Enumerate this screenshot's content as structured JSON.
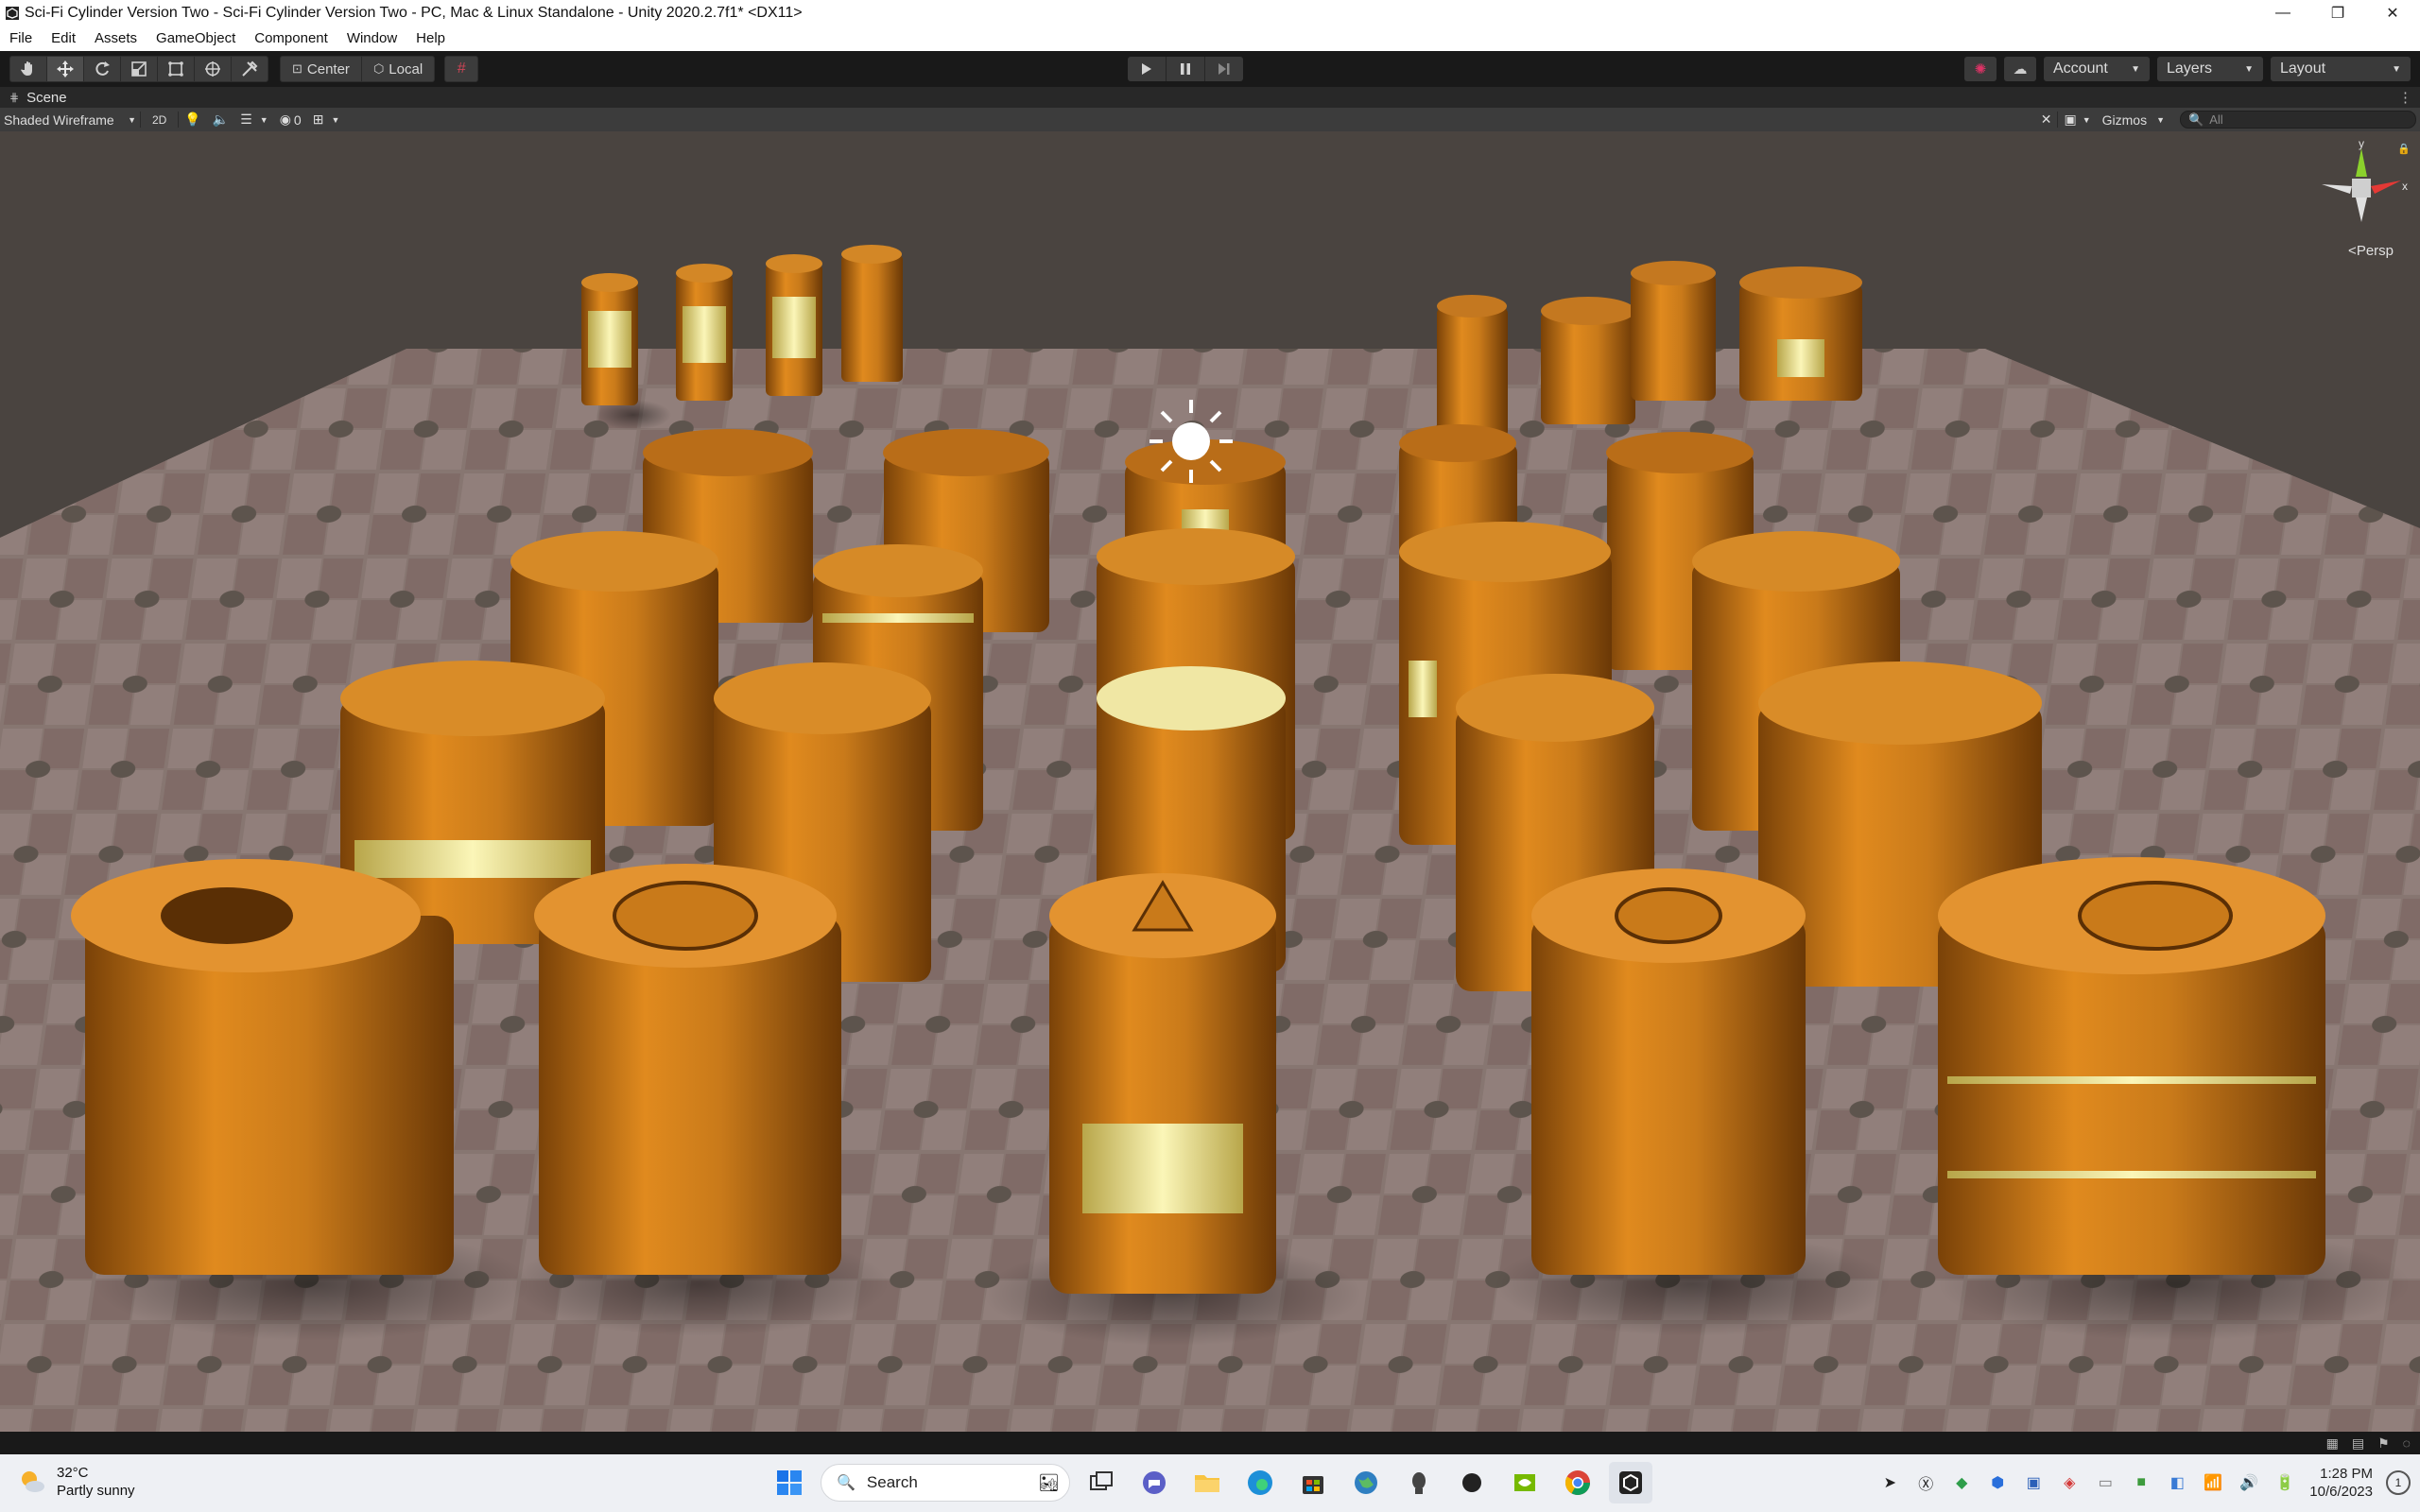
{
  "window": {
    "title": "Sci-Fi Cylinder Version Two - Sci-Fi Cylinder Version Two - PC, Mac & Linux Standalone - Unity 2020.2.7f1* <DX11>",
    "minimize": "—",
    "maximize": "❐",
    "close": "✕"
  },
  "menu": {
    "items": [
      "File",
      "Edit",
      "Assets",
      "GameObject",
      "Component",
      "Window",
      "Help"
    ]
  },
  "toolbar": {
    "pivot_mode": "Center",
    "pivot_rotation": "Local",
    "account": "Account",
    "layers": "Layers",
    "layout": "Layout"
  },
  "scene_tab": {
    "label": "Scene"
  },
  "scene_toolbar": {
    "draw_mode": "Shaded Wireframe",
    "mode_2d": "2D",
    "hidden_count": "0",
    "gizmos": "Gizmos",
    "search_placeholder": "All"
  },
  "viewport": {
    "projection_label": "Persp",
    "gizmo_axes": {
      "y": "y",
      "x": "x"
    },
    "colors": {
      "sky": "#4a4440",
      "floor": "#8c7a74",
      "model_orange": "#c97a1a",
      "model_dark": "#7a4208",
      "glow": "#f5efa0"
    }
  },
  "taskbar": {
    "weather_temp": "32°C",
    "weather_desc": "Partly sunny",
    "search_label": "Search",
    "time": "1:28 PM",
    "date": "10/6/2023",
    "notifications": "1"
  }
}
